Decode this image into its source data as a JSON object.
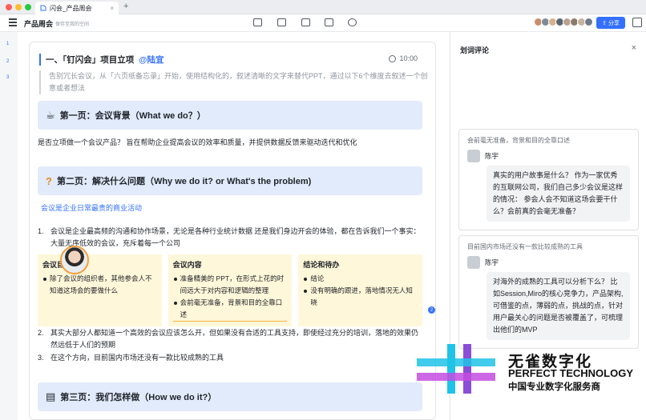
{
  "tab": {
    "title": "闪会_产品周会",
    "close": "×",
    "new": "+"
  },
  "toolbar": {
    "doc_title": "产品周会",
    "location": "保存至我的空间",
    "share_label": "分享"
  },
  "gutter": [
    "1",
    "2",
    "3"
  ],
  "doc": {
    "heading": "一、「钉闪会」项目立项",
    "mention": "@陆宜",
    "time": "10:00",
    "quote": "告别冗长会议，从「六页纸备忘录」开始，使用结构化的，叙述清晰的文字来替代PPT，通过以下6个维度去叙述一个创意或者想法",
    "sec1_icon": "☕",
    "sec1": "第一页：会议背景（What we do？）",
    "p1": "是否立项做一个会议产品？ 旨在帮助企业提高会议的效率和质量，并提供数据反馈来驱动迭代和优化",
    "sec2_icon": "?",
    "sec2": "第二页：解决什么问题（Why we do it? or What's the problem)",
    "blue_note": "会议是企业日常最贵的商业活动",
    "item1_num": "1.",
    "item1": "会议是企业最高频的沟通和协作场景，无论是各种行业统计数据 还是我们身边开会的体验，都在告诉我们一个事实：大量无序低效的会议，充斥着每一个公司",
    "cards": [
      {
        "title": "会议目标",
        "items": [
          "除了会议的组织者，其他参会人不知道这场会的要做什么"
        ]
      },
      {
        "title": "会议内容",
        "items": [
          "准备精美的 PPT，在形式上花的时间远大于对内容和逻辑的整理",
          "会前毫无准备，背景和目的全靠口述"
        ]
      },
      {
        "title": "结论和待办",
        "items": [
          "结论",
          "没有明确的跟进，落地情况无人知晓"
        ]
      }
    ],
    "comment_count": "2",
    "item2_num": "2.",
    "item2": "其实大部分人都知道一个高效的会议应该怎么开，但如果没有合适的工具支持，即使经过充分的培训，落地的效果仍然远低于人们的预期",
    "item3_num": "3.",
    "item3": "在这个方向，目前国内市场还没有一款比较成熟的工具",
    "sec3_icon": "▤",
    "sec3": "第三页：我们怎样做（How we do it?）"
  },
  "panel": {
    "title": "划词评论",
    "close": "×",
    "comments": [
      {
        "quote": "会前毫无准备，背景和目的全靠口述",
        "author": "陈宇",
        "text": "真实的用户故事是什么？ 作为一家优秀的互联网公司，我们自己多少会议是这样的情况： 参会人会不知道这场会要干什么？会前真的会毫无准备？"
      },
      {
        "quote": "目前国内市场还没有一款比较成熟的工具",
        "author": "陈宇",
        "text": "对海外的成熟的工具可以分析下么？ 比如Session,Miro的核心竞争力，产品架构,可借鉴的点，薄弱的点，挑战的点，针对用户最关心的问题是否被覆盖了，可梳理出他们的MVP"
      }
    ]
  },
  "logo": {
    "cn": "无雀数字化",
    "en": "PERFECT TECHNOLOGY",
    "sub": "中国专业数字化服务商"
  },
  "colors": {
    "accent": "#3370ff",
    "section_bg": "#e1ebfb",
    "card_bg": "#fef7d9"
  }
}
